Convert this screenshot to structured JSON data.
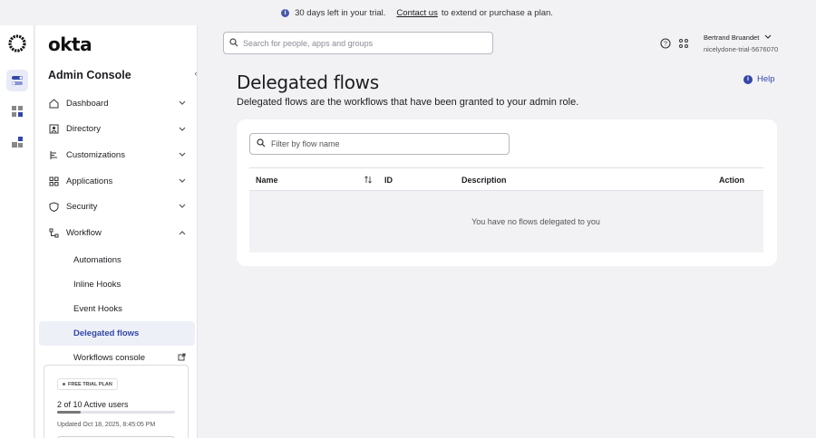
{
  "banner": {
    "trial_text": "30 days left in your trial.",
    "contact_link": "Contact us",
    "contact_suffix": "to extend or purchase a plan."
  },
  "brand": {
    "wordmark": "okta"
  },
  "rail": {
    "icons": [
      "workflow-toggle-icon",
      "apps-grid-icon",
      "app-switcher-icon"
    ]
  },
  "sidebar": {
    "title": "Admin Console",
    "items": [
      {
        "label": "Dashboard",
        "icon": "home-icon"
      },
      {
        "label": "Directory",
        "icon": "person-icon"
      },
      {
        "label": "Customizations",
        "icon": "brush-icon"
      },
      {
        "label": "Applications",
        "icon": "apps-icon"
      },
      {
        "label": "Security",
        "icon": "shield-icon"
      },
      {
        "label": "Workflow",
        "icon": "flow-icon"
      }
    ],
    "workflow_sub": [
      {
        "label": "Automations"
      },
      {
        "label": "Inline Hooks"
      },
      {
        "label": "Event Hooks"
      },
      {
        "label": "Delegated flows"
      },
      {
        "label": "Workflows console"
      }
    ]
  },
  "plan": {
    "badge": "FREE TRIAL PLAN",
    "users_text": "2 of 10 Active users",
    "users_used": 2,
    "users_total": 10,
    "updated": "Updated Oct 18, 2025, 8:45:05 PM"
  },
  "header": {
    "search_placeholder": "Search for people, apps and groups",
    "user_name": "Bertrand Bruandet",
    "user_org": "nicelydone-trial-5676070"
  },
  "page": {
    "title": "Delegated flows",
    "subtitle": "Delegated flows are the workflows that have been granted to your admin role.",
    "help_label": "Help"
  },
  "table": {
    "filter_placeholder": "Filter by flow name",
    "columns": {
      "name": "Name",
      "id": "ID",
      "description": "Description",
      "action": "Action"
    },
    "empty_message": "You have no flows delegated to you"
  },
  "colors": {
    "accent": "#3447a8",
    "background": "#f2f2f5",
    "active_nav_bg": "#eef0f8"
  }
}
